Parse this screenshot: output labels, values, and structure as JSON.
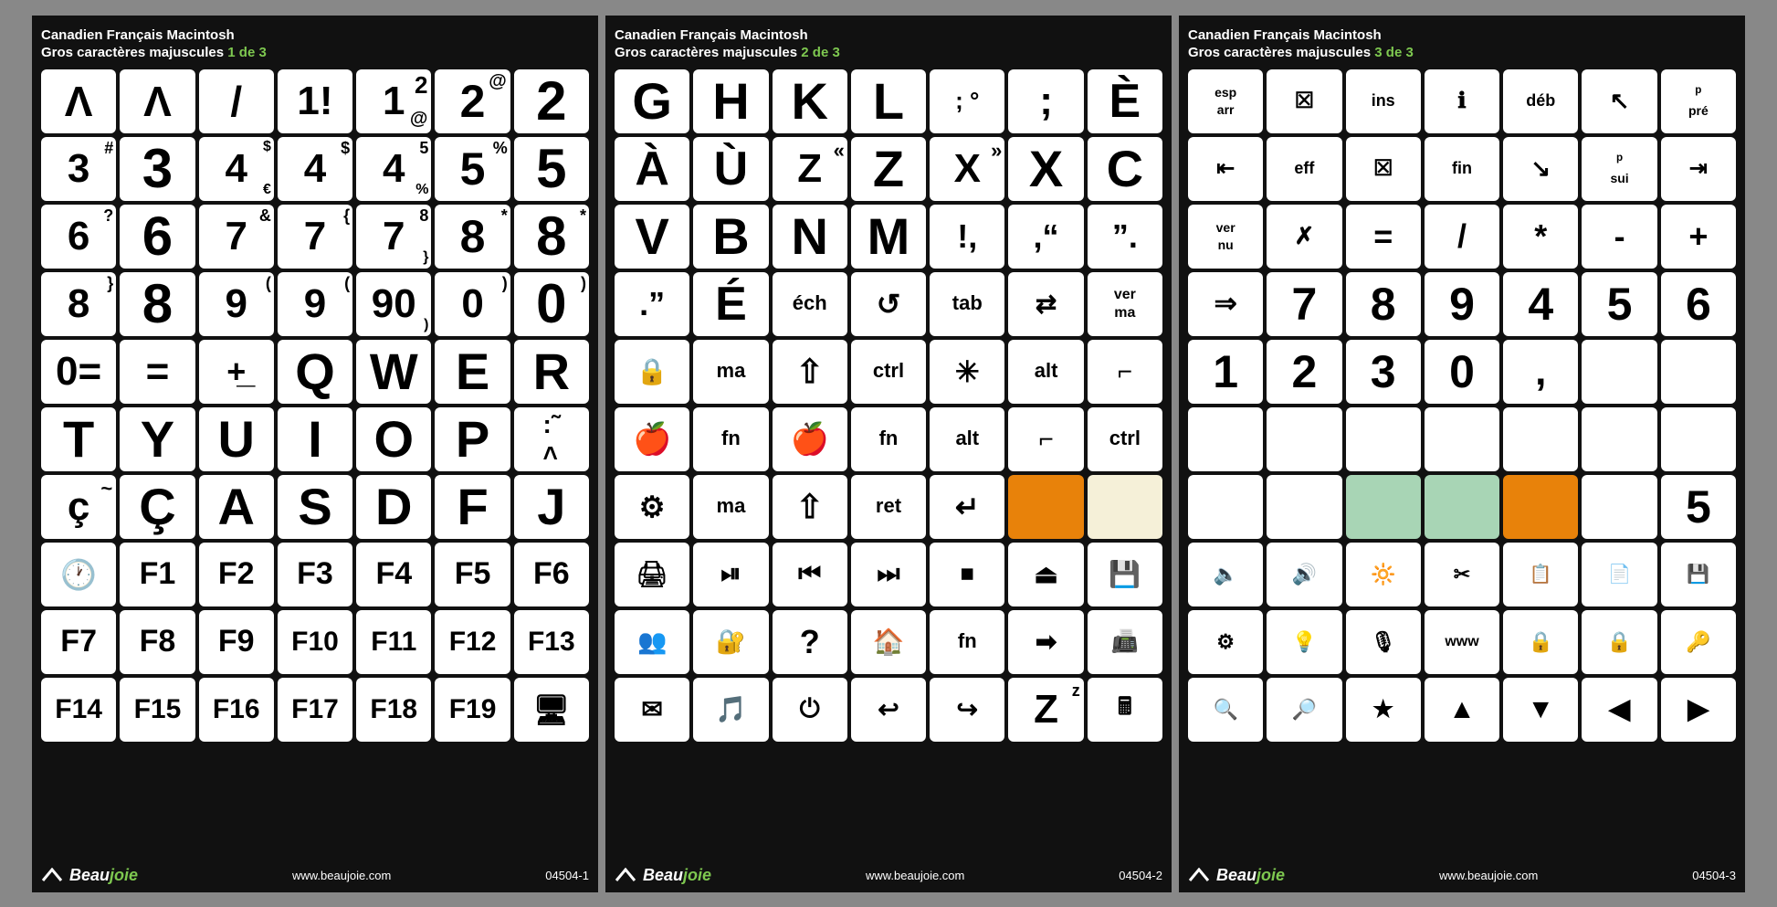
{
  "sheets": [
    {
      "id": "sheet1",
      "title_line1": "Canadien Français Macintosh",
      "title_line2": "Gros caractères majuscules",
      "page": "1 de 3",
      "product_code": "04504-1",
      "website": "www.beaujoie.com"
    },
    {
      "id": "sheet2",
      "title_line1": "Canadien Français Macintosh",
      "title_line2": "Gros caractères majuscules",
      "page": "2 de 3",
      "product_code": "04504-2",
      "website": "www.beaujoie.com"
    },
    {
      "id": "sheet3",
      "title_line1": "Canadien Français Macintosh",
      "title_line2": "Gros caractères majuscules",
      "page": "3 de 3",
      "product_code": "04504-3",
      "website": "www.beaujoie.com"
    }
  ],
  "brand": "Beaujoie",
  "accent_color": "#7ec850"
}
